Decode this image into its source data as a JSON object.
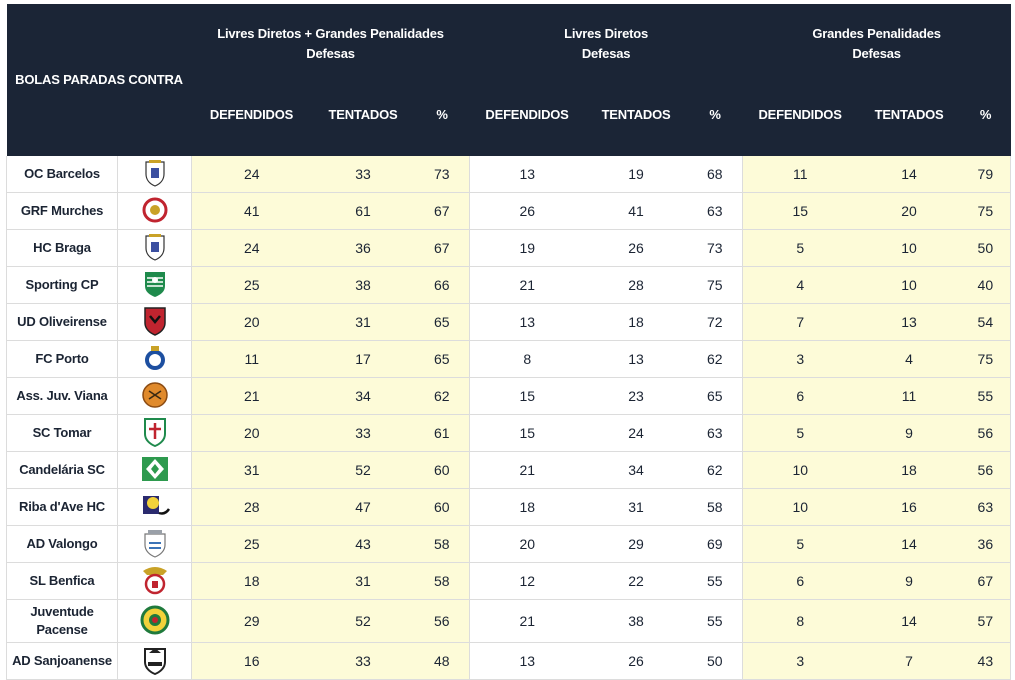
{
  "header": {
    "corner": "BOLAS PARADAS CONTRA",
    "groups": [
      {
        "line1": "Livres Diretos + Grandes Penalidades",
        "line2": "Defesas"
      },
      {
        "line1": "Livres Diretos",
        "line2": "Defesas"
      },
      {
        "line1": "Grandes Penalidades",
        "line2": "Defesas"
      }
    ],
    "cols": {
      "defended": "DEFENDIDOS",
      "attempted": "TENTADOS",
      "pct": "%"
    }
  },
  "colors": {
    "header_bg": "#1b2536",
    "highlight": "#fdfbd8"
  },
  "rows": [
    {
      "team": "OC Barcelos",
      "crest": "oc-barcelos-crest",
      "c": [
        "24",
        "33",
        "73",
        "13",
        "19",
        "68",
        "11",
        "14",
        "79"
      ]
    },
    {
      "team": "GRF Murches",
      "crest": "grf-murches-crest",
      "c": [
        "41",
        "61",
        "67",
        "26",
        "41",
        "63",
        "15",
        "20",
        "75"
      ]
    },
    {
      "team": "HC Braga",
      "crest": "hc-braga-crest",
      "c": [
        "24",
        "36",
        "67",
        "19",
        "26",
        "73",
        "5",
        "10",
        "50"
      ]
    },
    {
      "team": "Sporting CP",
      "crest": "sporting-cp-crest",
      "c": [
        "25",
        "38",
        "66",
        "21",
        "28",
        "75",
        "4",
        "10",
        "40"
      ]
    },
    {
      "team": "UD Oliveirense",
      "crest": "ud-oliveirense-crest",
      "c": [
        "20",
        "31",
        "65",
        "13",
        "18",
        "72",
        "7",
        "13",
        "54"
      ]
    },
    {
      "team": "FC Porto",
      "crest": "fc-porto-crest",
      "c": [
        "11",
        "17",
        "65",
        "8",
        "13",
        "62",
        "3",
        "4",
        "75"
      ]
    },
    {
      "team": "Ass. Juv. Viana",
      "crest": "ass-juv-viana-crest",
      "c": [
        "21",
        "34",
        "62",
        "15",
        "23",
        "65",
        "6",
        "11",
        "55"
      ]
    },
    {
      "team": "SC Tomar",
      "crest": "sc-tomar-crest",
      "c": [
        "20",
        "33",
        "61",
        "15",
        "24",
        "63",
        "5",
        "9",
        "56"
      ]
    },
    {
      "team": "Candelária SC",
      "crest": "candelaria-sc-crest",
      "c": [
        "31",
        "52",
        "60",
        "21",
        "34",
        "62",
        "10",
        "18",
        "56"
      ]
    },
    {
      "team": "Riba d'Ave HC",
      "crest": "riba-dave-hc-crest",
      "c": [
        "28",
        "47",
        "60",
        "18",
        "31",
        "58",
        "10",
        "16",
        "63"
      ]
    },
    {
      "team": "AD Valongo",
      "crest": "ad-valongo-crest",
      "c": [
        "25",
        "43",
        "58",
        "20",
        "29",
        "69",
        "5",
        "14",
        "36"
      ]
    },
    {
      "team": "SL Benfica",
      "crest": "sl-benfica-crest",
      "c": [
        "18",
        "31",
        "58",
        "12",
        "22",
        "55",
        "6",
        "9",
        "67"
      ]
    },
    {
      "team": "Juventude Pacense",
      "crest": "juventude-pacense-crest",
      "c": [
        "29",
        "52",
        "56",
        "21",
        "38",
        "55",
        "8",
        "14",
        "57"
      ]
    },
    {
      "team": "AD Sanjoanense",
      "crest": "ad-sanjoanense-crest",
      "c": [
        "16",
        "33",
        "48",
        "13",
        "26",
        "50",
        "3",
        "7",
        "43"
      ]
    }
  ]
}
